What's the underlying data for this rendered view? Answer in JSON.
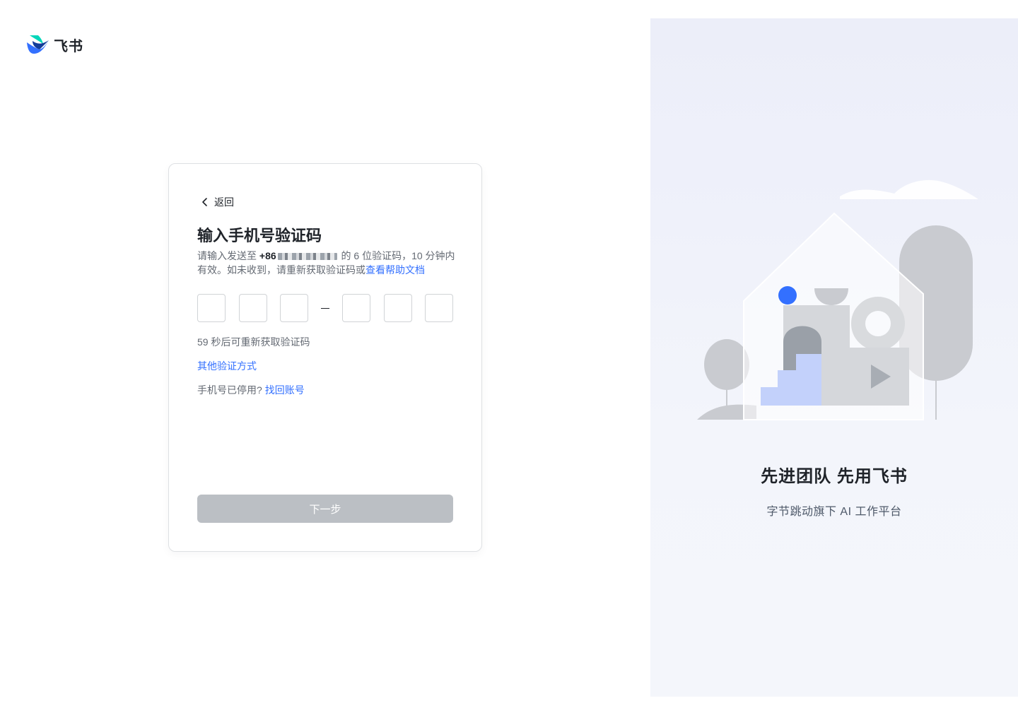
{
  "app": {
    "name": "飞书"
  },
  "form": {
    "back_label": "返回",
    "title": "输入手机号验证码",
    "desc_prefix": "请输入发送至 ",
    "phone_prefix": "+86",
    "desc_middle": " 的 6 位验证码，10 分钟内有效。如未收到，请重新获取验证码或",
    "help_link": "查看帮助文档",
    "code_boxes": [
      "",
      "",
      "",
      "",
      "",
      ""
    ],
    "countdown": "59 秒后可重新获取验证码",
    "other_methods": "其他验证方式",
    "stopped_question": "手机号已停用?",
    "recover_link": "找回账号",
    "next_button": "下一步"
  },
  "promo": {
    "slogan": "先进团队 先用飞书",
    "subtitle": "字节跳动旗下 AI 工作平台"
  },
  "colors": {
    "accent": "#3370ff",
    "disabled_button": "#bbbfc4",
    "panel_bg": "#eff1fa"
  },
  "icons": {
    "back": "chevron-left-icon",
    "logo": "feishu-logo-icon"
  }
}
